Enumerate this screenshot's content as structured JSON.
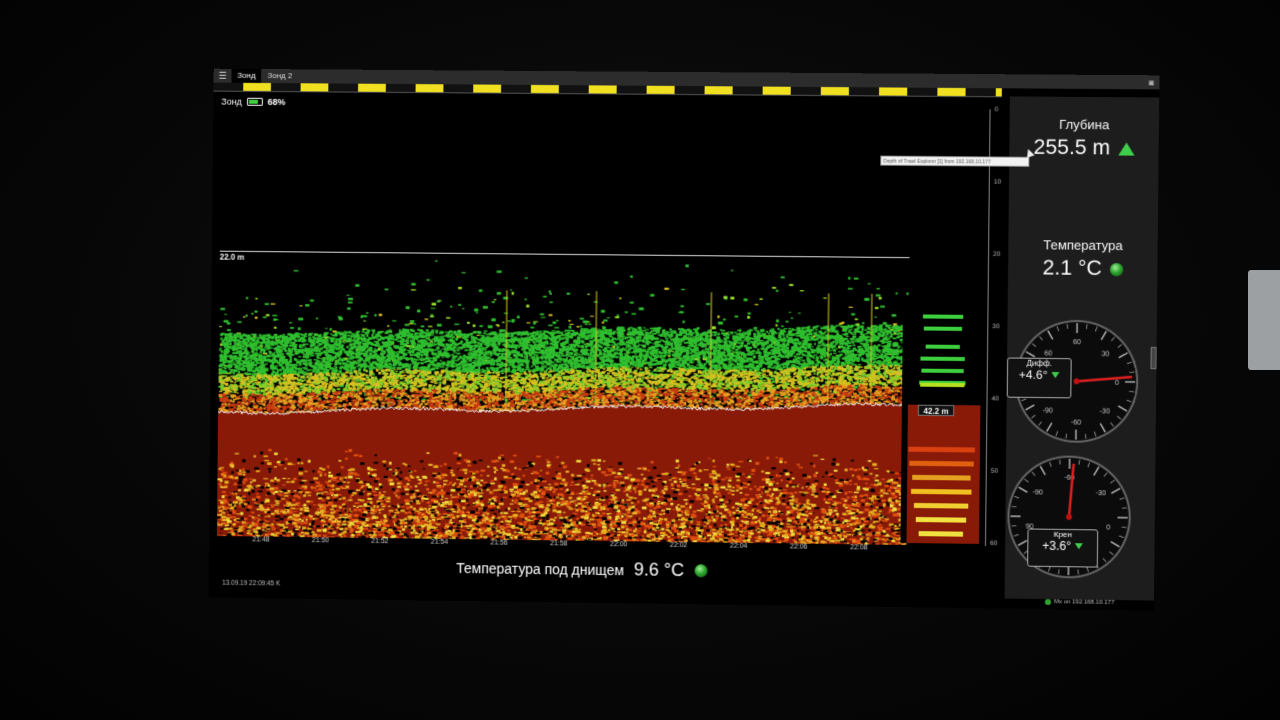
{
  "tabs": [
    "Зонд",
    "Зонд 2"
  ],
  "menu_icon": "hamburger-menu-icon",
  "camera_icon": "camera-icon",
  "sonar": {
    "label": "Зонд",
    "battery_percent": "68%",
    "battery_level": 0.68,
    "range_label": "22.0 m",
    "bottom_depth_label": "42.2 m"
  },
  "depth_ticks": [
    "0",
    "10",
    "20",
    "30",
    "40",
    "50",
    "60"
  ],
  "time_ticks": [
    "21:48",
    "21:50",
    "21:52",
    "21:54",
    "21:56",
    "21:58",
    "22:00",
    "22:02",
    "22:04",
    "22:06",
    "22:08"
  ],
  "tooltip": "Depth of Trawl Explorer [1] from 192.168.10.177",
  "readouts": {
    "depth": {
      "label": "Глубина",
      "value": "255.5 m"
    },
    "temperature": {
      "label": "Температура",
      "value": "2.1 °C"
    }
  },
  "gauges": {
    "diff": {
      "label": "Дифф.",
      "value": "+4.6°",
      "ticks": [
        "60",
        "30",
        "0",
        "-30",
        "-60",
        "-90",
        "90",
        "60"
      ]
    },
    "roll": {
      "label": "Крен",
      "value": "+3.6°",
      "ticks": [
        "-60",
        "-30",
        "0",
        "30",
        "60",
        "90",
        "-90"
      ]
    }
  },
  "bottom_temp": {
    "label": "Температура под днищем",
    "value": "9.6 °C"
  },
  "status_date": "13.09.19 22:09:45 K",
  "connection": "Mx on 192.168.10.177",
  "colors": {
    "stripe_yellow": "#f0e020",
    "echo_green": "#3ecf3e",
    "bottom_red": "#8a1a08",
    "panel": "#1d1d1d",
    "status_green": "#2ea52e"
  }
}
